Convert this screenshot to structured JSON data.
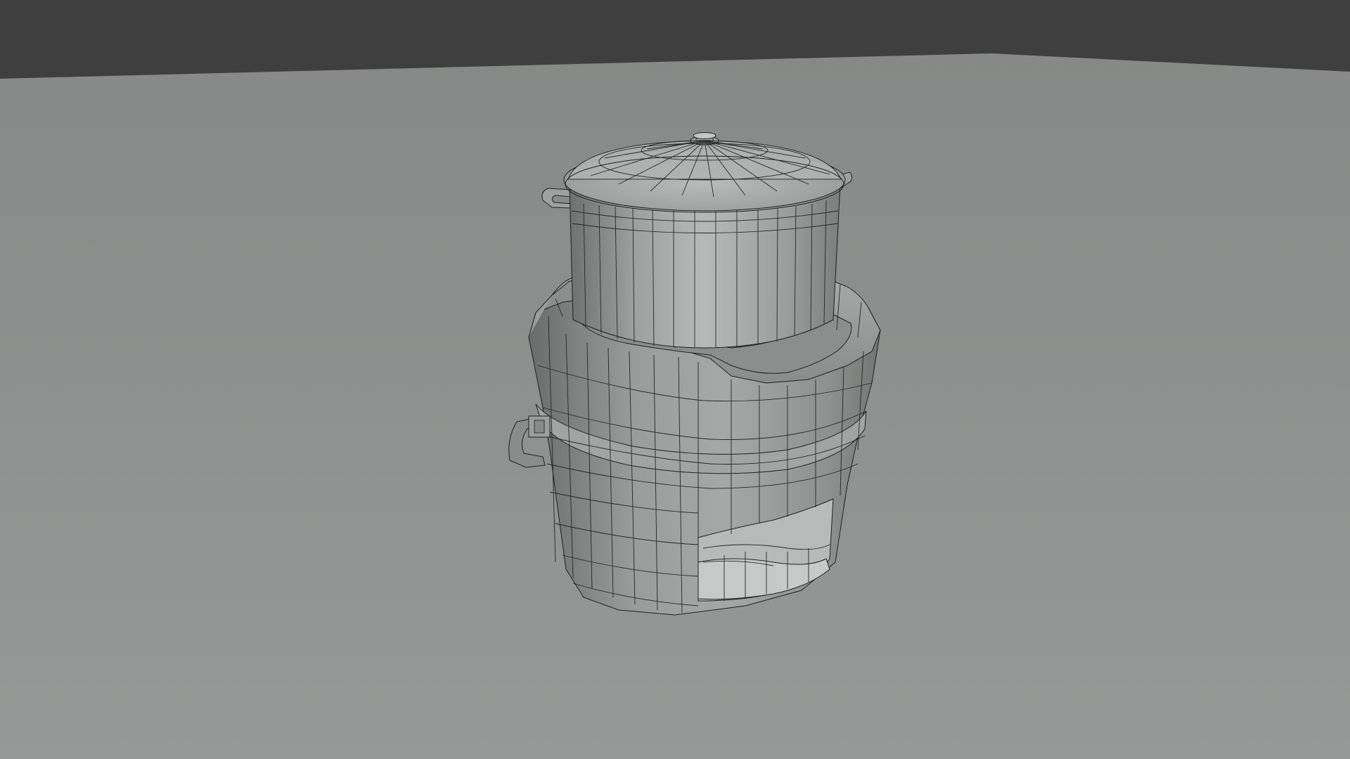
{
  "viewport": {
    "background_color": "#3f3f3f",
    "ground_color": "#8f9190",
    "shading_mode": "wireframe-on-shaded",
    "wire_color": "#1c1c1c"
  },
  "scene": {
    "objects": [
      {
        "name": "pot",
        "icon": "cooking-pot-icon"
      },
      {
        "name": "pot-lid",
        "icon": "lid-icon"
      },
      {
        "name": "stove",
        "icon": "stove-icon"
      },
      {
        "name": "stove-handle",
        "icon": "handle-icon"
      }
    ]
  }
}
